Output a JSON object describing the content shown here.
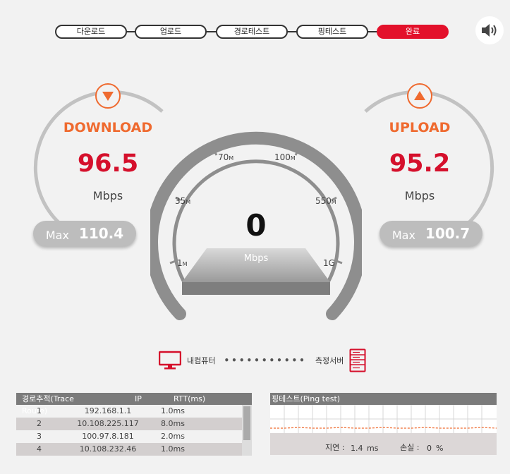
{
  "steps": [
    {
      "label": "다운로드",
      "active": false
    },
    {
      "label": "업로드",
      "active": false
    },
    {
      "label": "경로테스트",
      "active": false
    },
    {
      "label": "핑테스트",
      "active": false
    },
    {
      "label": "완료",
      "active": true
    }
  ],
  "download": {
    "title": "DOWNLOAD",
    "value": "96.5",
    "unit": "Mbps",
    "max_label": "Max",
    "max_value": "110.4"
  },
  "upload": {
    "title": "UPLOAD",
    "value": "95.2",
    "unit": "Mbps",
    "max_label": "Max",
    "max_value": "100.7"
  },
  "gauge": {
    "value": "0",
    "unit": "Mbps",
    "ticks": {
      "t1": "1",
      "t35": "35",
      "t70": "70",
      "t100": "100",
      "t550": "550",
      "t1g": "1G",
      "suffix": "M"
    }
  },
  "connection": {
    "left_label": "내컴퓨터",
    "dots": "•••••••••••",
    "right_label": "측정서버"
  },
  "trace": {
    "headers": {
      "hop": "경로추적(Trace Route)",
      "ip": "IP",
      "rtt": "RTT(ms)"
    },
    "rows": [
      {
        "hop": "1",
        "ip": "192.168.1.1",
        "rtt": "1.0ms"
      },
      {
        "hop": "2",
        "ip": "10.108.225.117",
        "rtt": "8.0ms"
      },
      {
        "hop": "3",
        "ip": "100.97.8.181",
        "rtt": "2.0ms"
      },
      {
        "hop": "4",
        "ip": "10.108.232.46",
        "rtt": "1.0ms"
      }
    ]
  },
  "ping": {
    "title": "핑테스트(Ping test)",
    "latency_label": "지연 :",
    "latency_value": "1.4",
    "latency_unit": "ms",
    "loss_label": "손실 :",
    "loss_value": "0",
    "loss_unit": "%"
  },
  "colors": {
    "accent": "#e3112b",
    "orange": "#ef6a2f",
    "value_red": "#d5102c"
  },
  "icons": {
    "sound": "speaker-icon",
    "down": "down-arrow-icon",
    "up": "up-arrow-icon",
    "computer": "computer-icon",
    "server": "server-icon"
  }
}
